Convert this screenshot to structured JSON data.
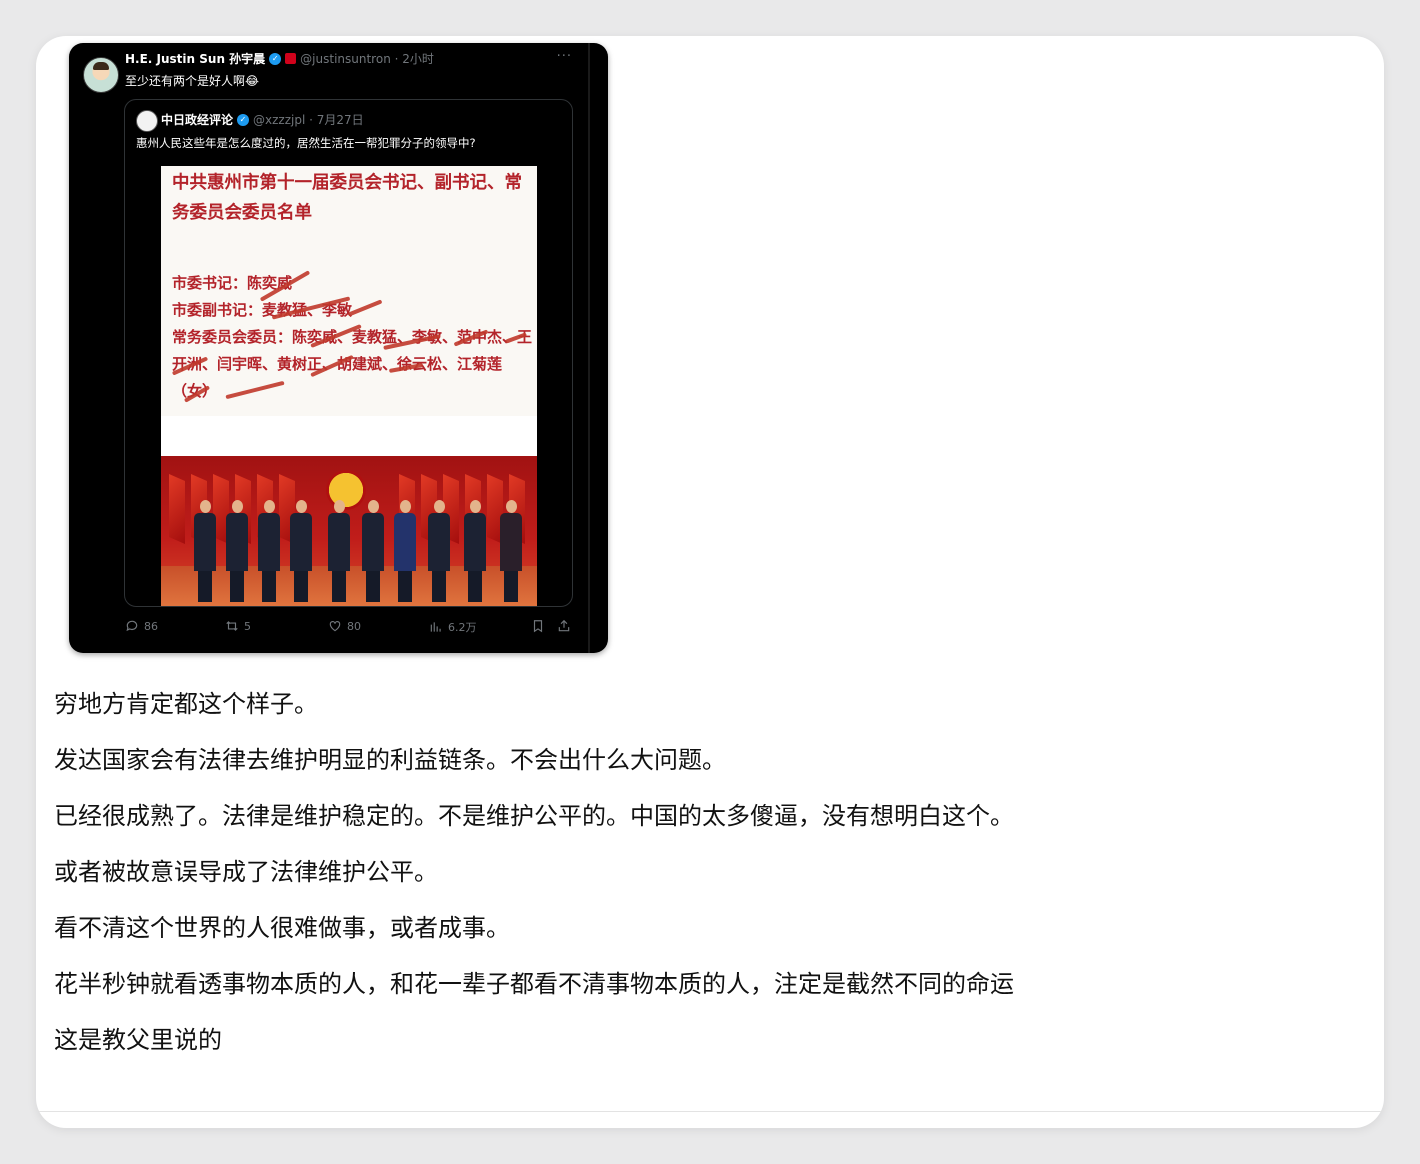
{
  "tweet": {
    "author_name": "H.E. Justin Sun 孙宇晨",
    "handle": "@justinsuntron · 2小时",
    "more": "···",
    "text": "至少还有两个是好人啊😂",
    "quote": {
      "name": "中日政经评论",
      "handle": "@xzzzjpl · 7月27日",
      "text": "惠州人民这些年是怎么度过的，居然生活在一帮犯罪分子的领导中?",
      "doc_title": "中共惠州市第十一届委员会书记、副书记、常务委员会委员名单",
      "doc_lines": [
        "市委书记：陈奕威",
        "市委副书记：麦教猛、李敏",
        "常务委员会委员：陈奕威、麦教猛、李敏、范中杰、王开洲、闫宇晖、黄树正、胡建斌、徐云松、江菊莲（女）"
      ]
    },
    "stats": {
      "replies": "86",
      "retweets": "5",
      "likes": "80",
      "views": "6.2万"
    }
  },
  "post_paragraphs": [
    "穷地方肯定都这个样子。",
    "发达国家会有法律去维护明显的利益链条。不会出什么大问题。",
    "已经很成熟了。法律是维护稳定的。不是维护公平的。中国的太多傻逼，没有想明白这个。",
    "或者被故意误导成了法律维护公平。",
    "看不清这个世界的人很难做事，或者成事。",
    "花半秒钟就看透事物本质的人，和花一辈子都看不清事物本质的人，注定是截然不同的命运",
    "这是教父里说的"
  ]
}
